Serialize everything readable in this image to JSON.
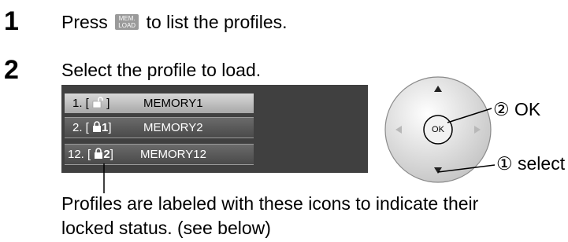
{
  "steps": [
    {
      "number": "1",
      "before": "Press",
      "button": {
        "line1": "MEM.",
        "line2": "LOAD"
      },
      "after": "to list the profiles."
    },
    {
      "number": "2",
      "text": "Select the profile to load."
    }
  ],
  "profiles": [
    {
      "number": "1. [",
      "lock": "",
      "close": "]",
      "name": "MEMORY1",
      "icon": "unlocked-icon",
      "selected": true
    },
    {
      "number": "2. [",
      "lock": "1",
      "close": "]",
      "name": "MEMORY2",
      "icon": "lock-1-icon",
      "selected": false
    },
    {
      "number": "12. [",
      "lock": "2",
      "close": "]",
      "name": "MEMORY12",
      "icon": "lock-2-icon",
      "selected": false
    }
  ],
  "remote": {
    "ok_button": "OK",
    "ok_label": "② OK",
    "select_label": "① select"
  },
  "caption": {
    "line1": "Profiles are labeled with these icons to indicate their",
    "line2": "locked status. (see below)"
  }
}
